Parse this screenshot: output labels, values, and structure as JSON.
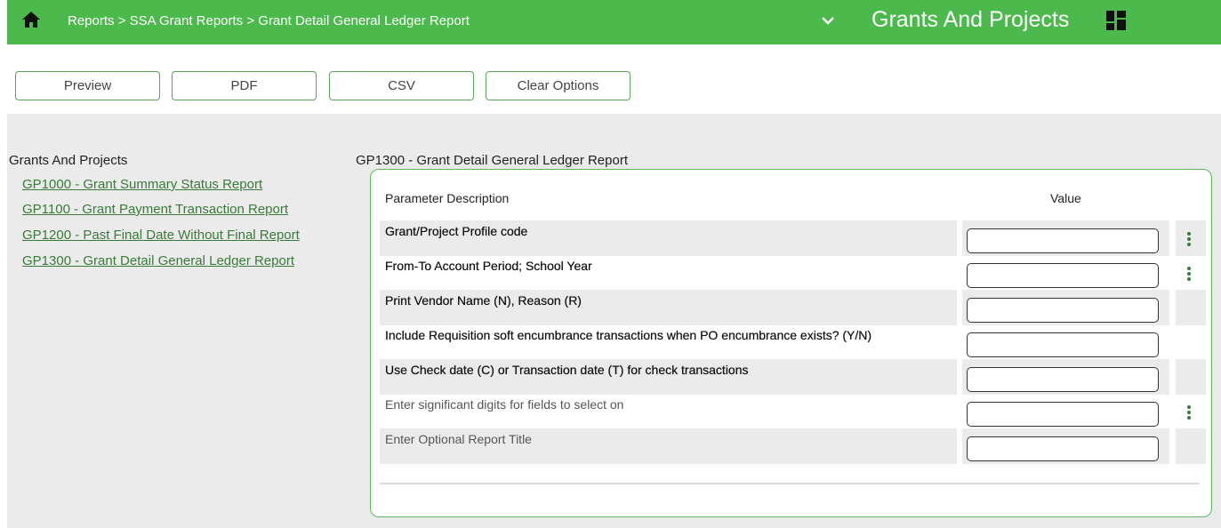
{
  "header": {
    "breadcrumb": "Reports > SSA Grant Reports > Grant Detail General Ledger Report",
    "app_title": "Grants And Projects",
    "bg_color": "#4cb94c"
  },
  "toolbar": {
    "preview_label": "Preview",
    "pdf_label": "PDF",
    "csv_label": "CSV",
    "clear_label": "Clear Options"
  },
  "leftnav": {
    "title": "Grants And Projects",
    "items": [
      {
        "label": "GP1000 - Grant Summary Status Report"
      },
      {
        "label": "GP1100 - Grant Payment Transaction Report"
      },
      {
        "label": "GP1200 - Past Final Date Without Final Report"
      },
      {
        "label": "GP1300 - Grant Detail General Ledger Report"
      }
    ]
  },
  "report": {
    "title": "GP1300 - Grant Detail General Ledger Report",
    "col_desc": "Parameter Description",
    "col_value": "Value",
    "params": [
      {
        "label": "Grant/Project Profile code",
        "value": "",
        "has_lookup": true
      },
      {
        "label": "From-To Account Period; School Year",
        "value": "",
        "has_lookup": true
      },
      {
        "label": "Print Vendor Name (N), Reason (R)",
        "value": "",
        "has_lookup": false
      },
      {
        "label": "Include Requisition soft encumbrance transactions when PO encumbrance exists? (Y/N)",
        "value": "",
        "has_lookup": false
      },
      {
        "label": "Use Check date (C) or Transaction date (T) for check transactions",
        "value": "",
        "has_lookup": false
      },
      {
        "label": "Enter significant digits for fields to select on",
        "value": "",
        "has_lookup": true
      },
      {
        "label": "Enter Optional Report Title",
        "value": "",
        "has_lookup": false
      }
    ]
  },
  "icons": {
    "home": "home-icon",
    "chevron": "chevron-down-icon",
    "menu": "grid-menu-icon",
    "lookup": "kebab-menu-icon"
  }
}
